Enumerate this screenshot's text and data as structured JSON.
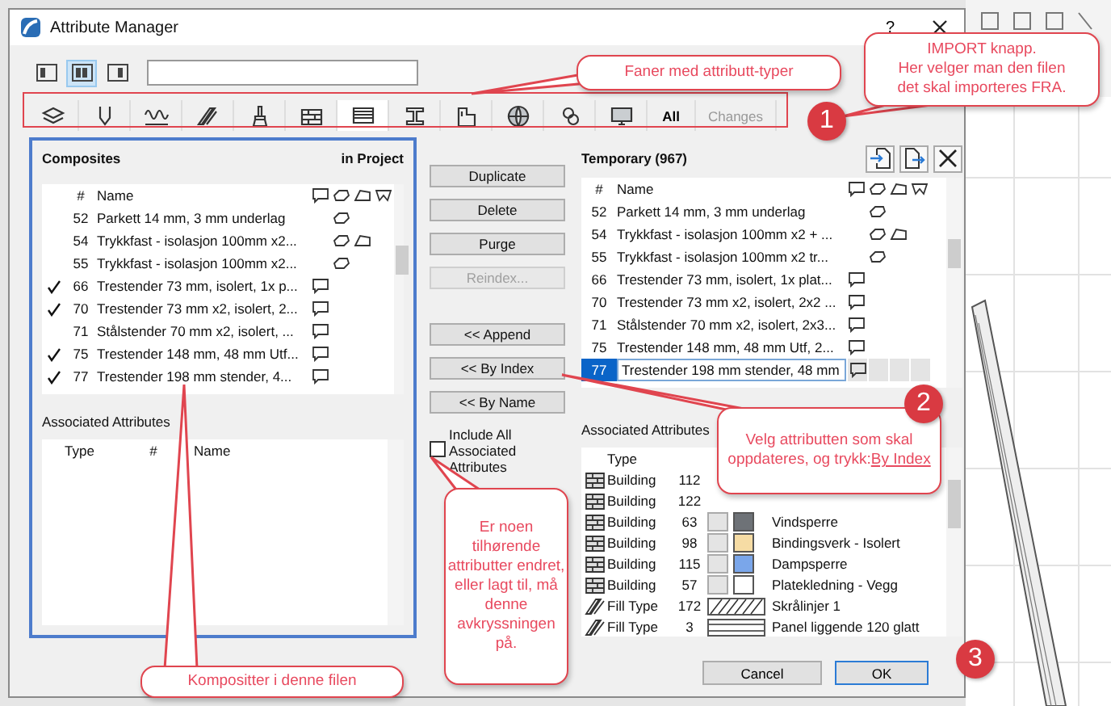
{
  "window": {
    "title": "Attribute Manager",
    "help": "?"
  },
  "view_buttons": [
    {
      "selected": false
    },
    {
      "selected": true
    },
    {
      "selected": false
    }
  ],
  "tabs": [
    {
      "kind": "layers",
      "selected": false
    },
    {
      "kind": "pen",
      "selected": false
    },
    {
      "kind": "line",
      "selected": false
    },
    {
      "kind": "fill",
      "selected": false
    },
    {
      "kind": "brush",
      "selected": false
    },
    {
      "kind": "brick",
      "selected": false
    },
    {
      "kind": "pattern",
      "selected": true
    },
    {
      "kind": "beam",
      "selected": false
    },
    {
      "kind": "plan",
      "selected": false
    },
    {
      "kind": "globe",
      "selected": false
    },
    {
      "kind": "link",
      "selected": false
    },
    {
      "kind": "monitor",
      "selected": false
    },
    {
      "kind": "text",
      "label": "All",
      "selected": false,
      "disabled": false
    },
    {
      "kind": "text",
      "label": "Changes",
      "selected": false,
      "disabled": true
    }
  ],
  "left_panel": {
    "title": "Composites",
    "subtitle": "in Project",
    "columns": [
      "#",
      "Name"
    ],
    "rows": [
      {
        "checked": false,
        "number": "52",
        "name": "Parkett 14 mm, 3 mm underlag",
        "flags": [
          false,
          true,
          false,
          false
        ]
      },
      {
        "checked": false,
        "number": "54",
        "name": "Trykkfast - isolasjon 100mm x2...",
        "flags": [
          false,
          true,
          true,
          false
        ]
      },
      {
        "checked": false,
        "number": "55",
        "name": "Trykkfast - isolasjon 100mm x2...",
        "flags": [
          false,
          true,
          false,
          false
        ]
      },
      {
        "checked": true,
        "number": "66",
        "name": "Trestender 73 mm, isolert, 1x p...",
        "flags": [
          true,
          false,
          false,
          false
        ]
      },
      {
        "checked": true,
        "number": "70",
        "name": "Trestender 73 mm x2, isolert, 2...",
        "flags": [
          true,
          false,
          false,
          false
        ]
      },
      {
        "checked": false,
        "number": "71",
        "name": "Stålstender 70 mm x2, isolert, ...",
        "flags": [
          true,
          false,
          false,
          false
        ]
      },
      {
        "checked": true,
        "number": "75",
        "name": "Trestender 148 mm, 48 mm Utf...",
        "flags": [
          true,
          false,
          false,
          false
        ]
      },
      {
        "checked": true,
        "number": "77",
        "name": "Trestender 198 mm stender, 4...",
        "flags": [
          true,
          false,
          false,
          false
        ]
      }
    ],
    "associated": {
      "title": "Associated Attributes",
      "columns": [
        "Type",
        "#",
        "Name"
      ]
    }
  },
  "edit_buttons": [
    {
      "label": "Duplicate",
      "disabled": false
    },
    {
      "label": "Delete",
      "disabled": false
    },
    {
      "label": "Purge",
      "disabled": false
    },
    {
      "label": "Reindex...",
      "disabled": true
    }
  ],
  "transfer_buttons": [
    {
      "label": "<< Append",
      "disabled": false
    },
    {
      "label": "<< By Index",
      "disabled": false
    },
    {
      "label": "<< By Name",
      "disabled": false
    }
  ],
  "include_all": {
    "label": "Include All Associated Attributes",
    "checked": false
  },
  "right_panel": {
    "title": "Temporary (967)",
    "columns": [
      "#",
      "Name"
    ],
    "rows": [
      {
        "selected": false,
        "number": "52",
        "name": "Parkett 14 mm, 3 mm underlag",
        "flags": [
          false,
          true,
          false,
          false
        ]
      },
      {
        "selected": false,
        "number": "54",
        "name": "Trykkfast - isolasjon 100mm x2 + ...",
        "flags": [
          false,
          true,
          true,
          false
        ]
      },
      {
        "selected": false,
        "number": "55",
        "name": "Trykkfast - isolasjon 100mm x2 tr...",
        "flags": [
          false,
          true,
          false,
          false
        ]
      },
      {
        "selected": false,
        "number": "66",
        "name": "Trestender 73 mm, isolert, 1x plat...",
        "flags": [
          true,
          false,
          false,
          false
        ]
      },
      {
        "selected": false,
        "number": "70",
        "name": "Trestender 73 mm x2, isolert, 2x2 ...",
        "flags": [
          true,
          false,
          false,
          false
        ]
      },
      {
        "selected": false,
        "number": "71",
        "name": "Stålstender 70 mm x2, isolert, 2x3...",
        "flags": [
          true,
          false,
          false,
          false
        ]
      },
      {
        "selected": false,
        "number": "75",
        "name": "Trestender 148 mm, 48 mm Utf, 2...",
        "flags": [
          true,
          false,
          false,
          false
        ]
      },
      {
        "selected": true,
        "number": "77",
        "name": "Trestender 198 mm stender, 48 mm",
        "flags": [
          true,
          false,
          false,
          false
        ]
      }
    ],
    "associated": {
      "title": "Associated Attributes",
      "columns": [
        "Type"
      ],
      "rows": [
        {
          "kind": "building",
          "type": "Building",
          "number": "112"
        },
        {
          "kind": "building",
          "type": "Building",
          "number": "122"
        },
        {
          "kind": "building",
          "type": "Building",
          "number": "63",
          "name": "Vindsperre",
          "color": "#6e7277"
        },
        {
          "kind": "building",
          "type": "Building",
          "number": "98",
          "name": "Bindingsverk - Isolert",
          "color": "#f6dca4"
        },
        {
          "kind": "building",
          "type": "Building",
          "number": "115",
          "name": "Dampsperre",
          "color": "#7aa6ea"
        },
        {
          "kind": "building",
          "type": "Building",
          "number": "57",
          "name": "Platekledning - Vegg",
          "color": "#ffffff"
        },
        {
          "kind": "hatch",
          "type": "Fill Type",
          "number": "172",
          "name": "Skrålinjer 1"
        },
        {
          "kind": "stripes",
          "type": "Fill Type",
          "number": "3",
          "name": "Panel liggende 120 glatt"
        }
      ]
    }
  },
  "footer_buttons": [
    {
      "label": "Cancel",
      "default": false
    },
    {
      "label": "OK",
      "default": true
    }
  ],
  "callouts": [
    {
      "text": "Faner med attributt-typer"
    },
    {
      "text": "IMPORT knapp.\nHer velger man den filen\ndet skal importeres FRA."
    },
    {
      "text": "Velg attributten som skal oppdateres, og trykk:",
      "link": "By Index"
    },
    {
      "text": "Er noen tilhørende attributter endret, eller lagt til, må denne avkryssningen på."
    },
    {
      "text": "Kompositter i denne filen"
    }
  ],
  "steps": [
    "1",
    "2",
    "3"
  ]
}
